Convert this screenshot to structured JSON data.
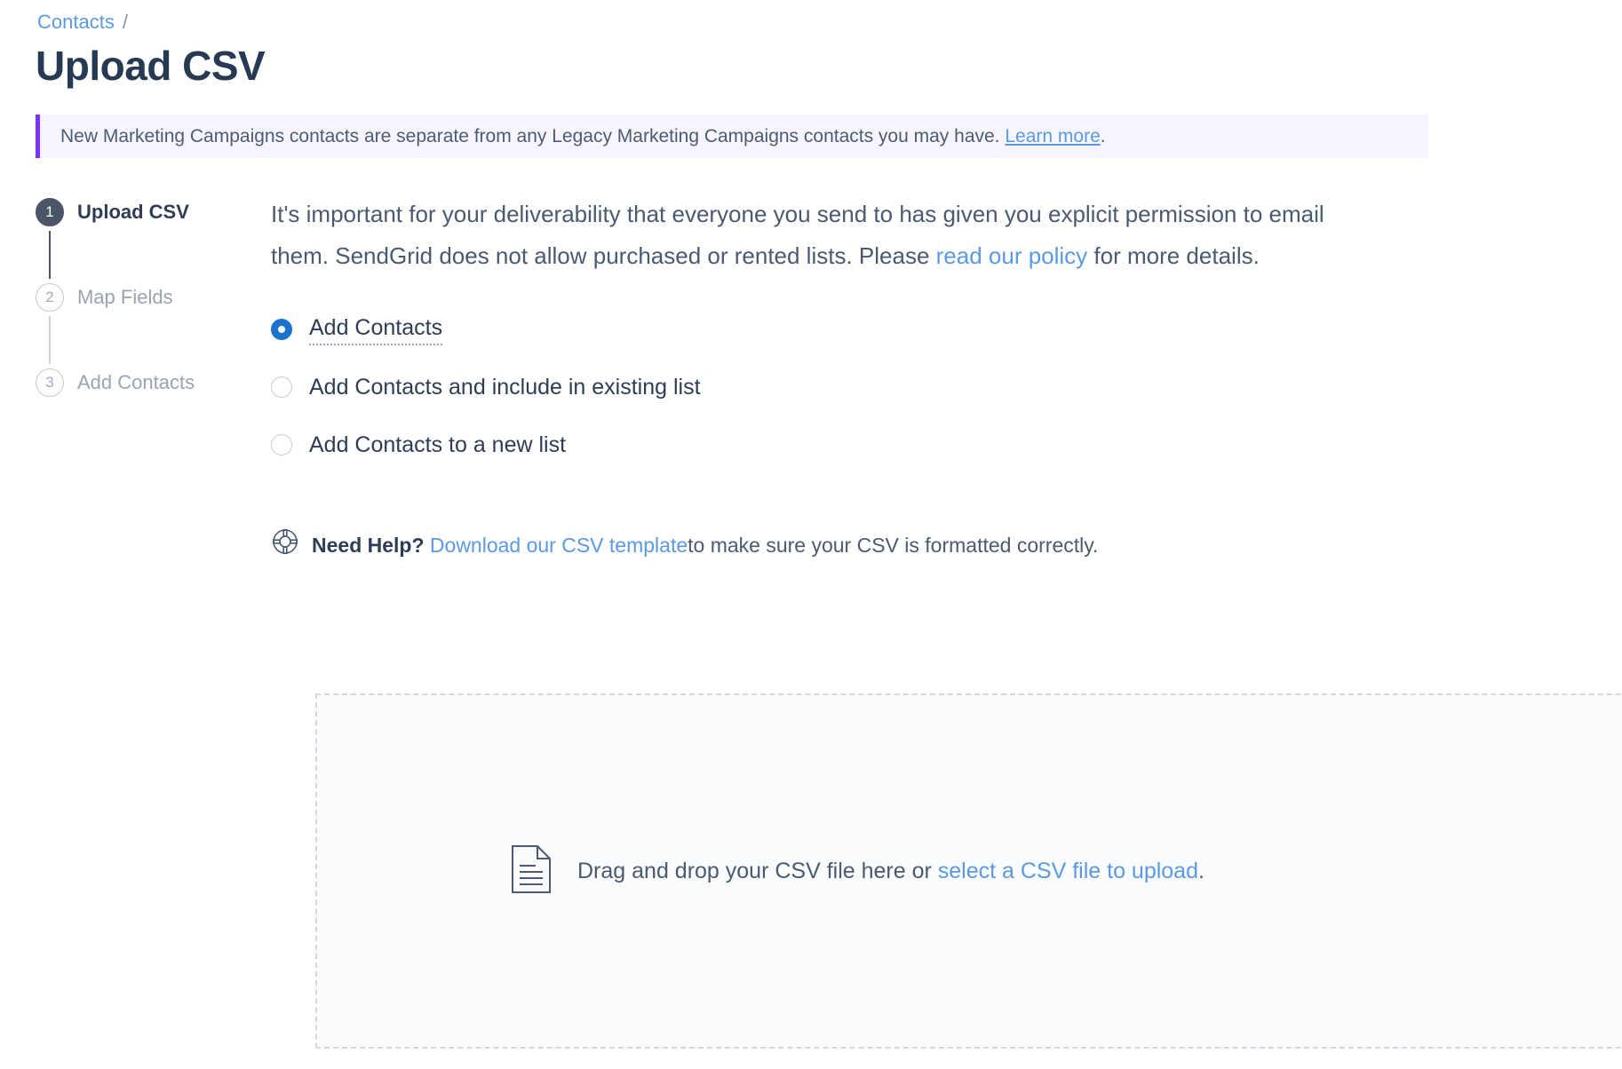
{
  "breadcrumb": {
    "parent": "Contacts",
    "separator": "/"
  },
  "page_title": "Upload CSV",
  "notice": {
    "text_before": "New Marketing Campaigns contacts are separate from any Legacy Marketing Campaigns contacts you may have.",
    "link": "Learn more",
    "text_after": ".",
    "accent_color": "#7d2fff",
    "background_color": "#f6f4fc"
  },
  "stepper": {
    "steps": [
      {
        "number": "1",
        "label": "Upload CSV",
        "state": "active"
      },
      {
        "number": "2",
        "label": "Map Fields",
        "state": "inactive"
      },
      {
        "number": "3",
        "label": "Add Contacts",
        "state": "inactive"
      }
    ]
  },
  "main": {
    "intro_before": "It's important for your deliverability that everyone you send to has given you explicit permission to email them. SendGrid does not allow purchased or rented lists. Please ",
    "intro_link": "read our policy",
    "intro_after": " for more details.",
    "radio_options": [
      {
        "label": "Add Contacts",
        "selected": true
      },
      {
        "label": "Add Contacts and include in existing list",
        "selected": false
      },
      {
        "label": "Add Contacts to a new list",
        "selected": false
      }
    ],
    "need_help": {
      "icon": "lifebuoy-icon",
      "bold_text": "Need Help?",
      "link": "Download our CSV template",
      "text_after": " to make sure your CSV is formatted correctly."
    },
    "dropzone": {
      "icon": "document-icon",
      "text_before": "Drag and drop your CSV file here or ",
      "link": "select a CSV file to upload",
      "text_after": "."
    }
  },
  "colors": {
    "link": "#5b9ae0",
    "radio_selected": "#1a73cc",
    "title": "#263a53",
    "step_active": "#4a5568"
  }
}
